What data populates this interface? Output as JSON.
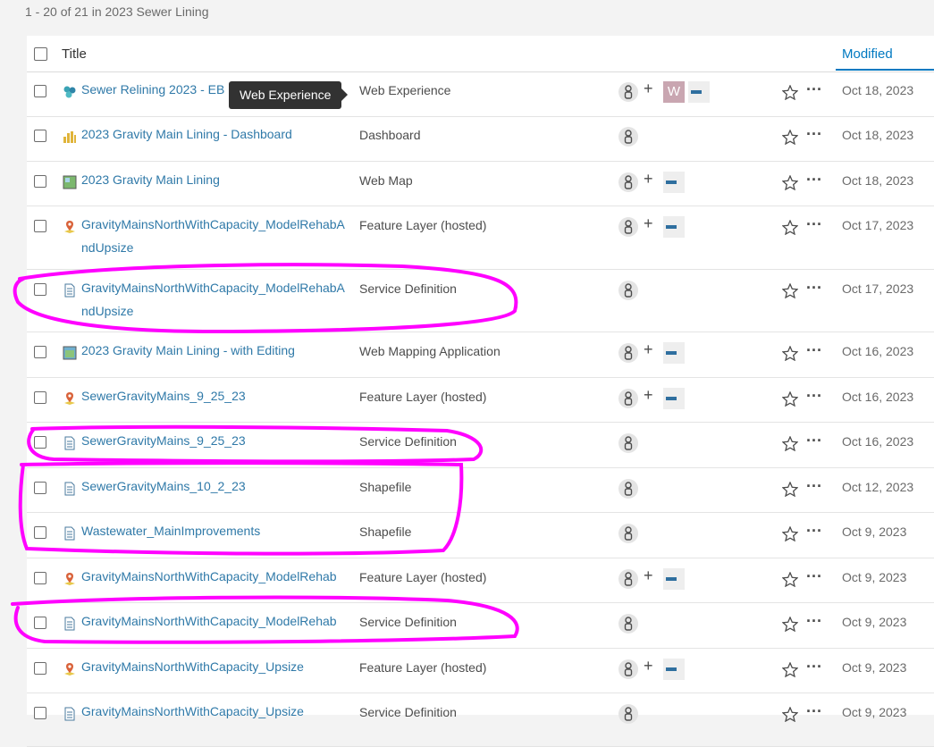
{
  "summary": "1 - 20 of 21 in 2023 Sewer Lining",
  "header": {
    "title_label": "Title",
    "modified_label": "Modified"
  },
  "tooltip": "Web Experience",
  "annotation_color": "#ff00ff",
  "rows": [
    {
      "title": "Sewer Relining 2023 - EB",
      "type": "Web Experience",
      "date": "Oct 18, 2023",
      "icon": "web-experience-icon",
      "extra": [
        "w-badge",
        "thumbnail"
      ]
    },
    {
      "title": "2023 Gravity Main Lining - Dashboard",
      "type": "Dashboard",
      "date": "Oct 18, 2023",
      "icon": "dashboard-icon",
      "extra": []
    },
    {
      "title": "2023 Gravity Main Lining",
      "type": "Web Map",
      "date": "Oct 18, 2023",
      "icon": "web-map-icon",
      "extra": [
        "thumbnail"
      ]
    },
    {
      "title": "GravityMainsNorthWithCapacity_ModelRehabAndUpsize",
      "type": "Feature Layer (hosted)",
      "date": "Oct 17, 2023",
      "icon": "feature-layer-icon",
      "extra": [
        "thumbnail"
      ]
    },
    {
      "title": "GravityMainsNorthWithCapacity_ModelRehabAndUpsize",
      "type": "Service Definition",
      "date": "Oct 17, 2023",
      "icon": "document-icon",
      "extra": []
    },
    {
      "title": "2023 Gravity Main Lining - with Editing",
      "type": "Web Mapping Application",
      "date": "Oct 16, 2023",
      "icon": "web-app-icon",
      "extra": [
        "thumbnail"
      ]
    },
    {
      "title": "SewerGravityMains_9_25_23",
      "type": "Feature Layer (hosted)",
      "date": "Oct 16, 2023",
      "icon": "feature-layer-icon",
      "extra": [
        "thumbnail"
      ]
    },
    {
      "title": "SewerGravityMains_9_25_23",
      "type": "Service Definition",
      "date": "Oct 16, 2023",
      "icon": "document-icon",
      "extra": []
    },
    {
      "title": "SewerGravityMains_10_2_23",
      "type": "Shapefile",
      "date": "Oct 12, 2023",
      "icon": "document-icon",
      "extra": []
    },
    {
      "title": "Wastewater_MainImprovements",
      "type": "Shapefile",
      "date": "Oct 9, 2023",
      "icon": "document-icon",
      "extra": []
    },
    {
      "title": "GravityMainsNorthWithCapacity_ModelRehab",
      "type": "Feature Layer (hosted)",
      "date": "Oct 9, 2023",
      "icon": "feature-layer-icon",
      "extra": [
        "thumbnail"
      ]
    },
    {
      "title": "GravityMainsNorthWithCapacity_ModelRehab",
      "type": "Service Definition",
      "date": "Oct 9, 2023",
      "icon": "document-icon",
      "extra": []
    },
    {
      "title": "GravityMainsNorthWithCapacity_Upsize",
      "type": "Feature Layer (hosted)",
      "date": "Oct 9, 2023",
      "icon": "feature-layer-icon",
      "extra": [
        "thumbnail"
      ]
    },
    {
      "title": "GravityMainsNorthWithCapacity_Upsize",
      "type": "Service Definition",
      "date": "Oct 9, 2023",
      "icon": "document-icon",
      "extra": []
    }
  ]
}
